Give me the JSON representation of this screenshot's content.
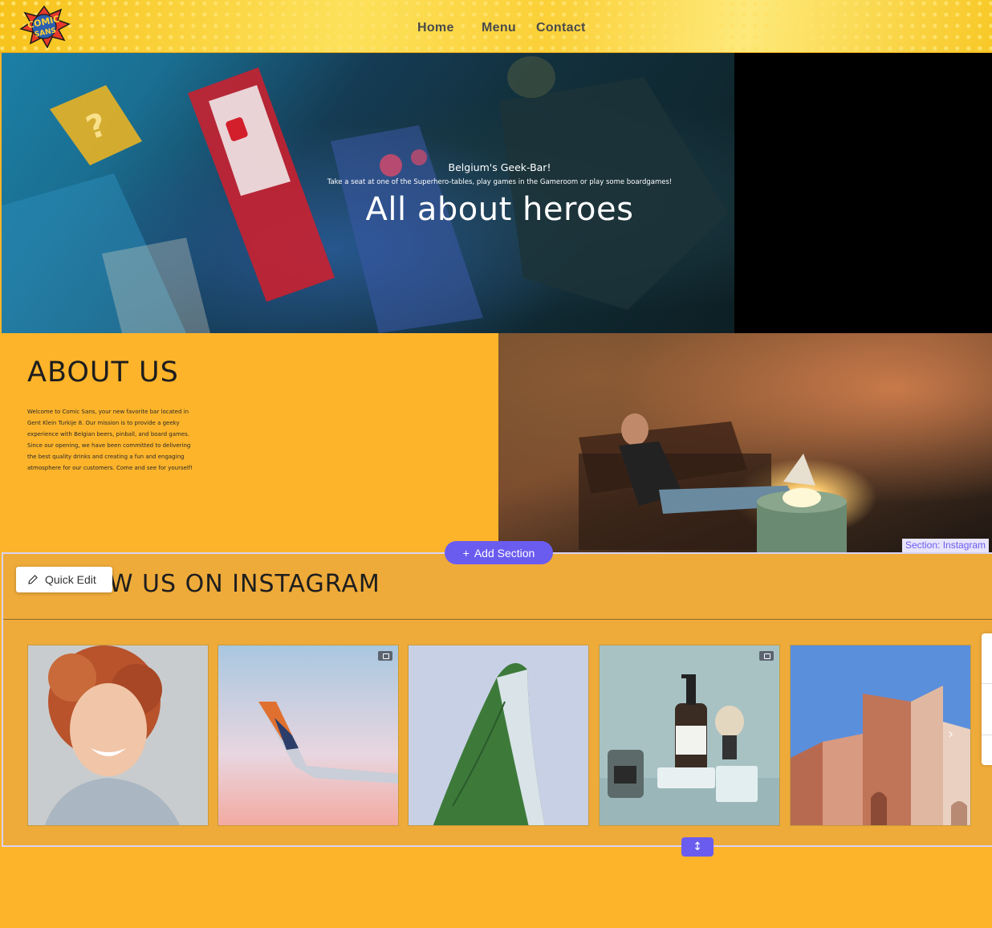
{
  "nav": {
    "home": "Home",
    "menu": "Menu",
    "contact": "Contact"
  },
  "hero": {
    "kicker": "Belgium's Geek-Bar!",
    "subtitle": "Take a seat at one of the Superhero-tables, play games in the Gameroom or play some boardgames!",
    "title": "All about heroes"
  },
  "about": {
    "title": "ABOUT US",
    "body": "Welcome to Comic Sans, your new favorite bar located in Gent Klein Turkije 8. Our mission is to provide a geeky experience with Belgian beers, pinball, and board games. Since our opening, we have been committed to delivering the best quality drinks and creating a fun and engaging atmosphere for our customers. Come and see for yourself!"
  },
  "instagram": {
    "title": "FOLLOW US ON INSTAGRAM"
  },
  "editor": {
    "add_section": "Add Section",
    "section_label": "Section: Instagram",
    "quick_edit": "Quick Edit"
  },
  "colors": {
    "accent": "#fdb42a",
    "editor_purple": "#6b5cf0"
  }
}
